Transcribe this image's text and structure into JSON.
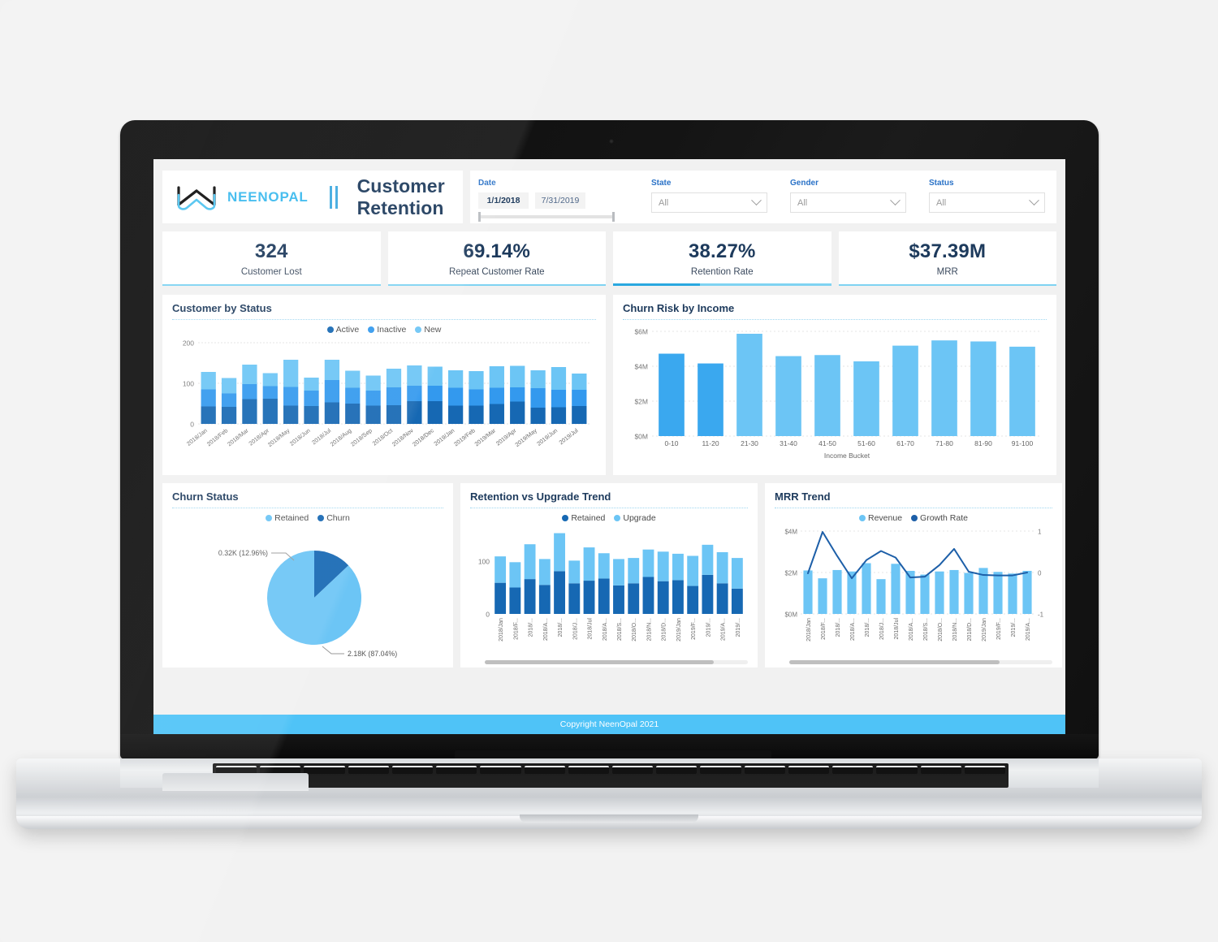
{
  "brand": {
    "name": "NEENOPAL",
    "logo_icon": "infinity-logo-icon"
  },
  "header": {
    "title": "Customer Retention"
  },
  "filters": {
    "date": {
      "label": "Date",
      "start": "1/1/2018",
      "end": "7/31/2019"
    },
    "state": {
      "label": "State",
      "value": "All"
    },
    "gender": {
      "label": "Gender",
      "value": "All"
    },
    "status": {
      "label": "Status",
      "value": "All"
    }
  },
  "kpis": [
    {
      "value": "324",
      "label": "Customer Lost"
    },
    {
      "value": "69.14%",
      "label": "Repeat Customer Rate"
    },
    {
      "value": "38.27%",
      "label": "Retention Rate"
    },
    {
      "value": "$37.39M",
      "label": "MRR"
    }
  ],
  "colors": {
    "dark_blue": "#1668b3",
    "mid_blue": "#3399ee",
    "light_blue": "#6cc5f5",
    "accent": "#4fc3f7",
    "title": "#1d3a5c"
  },
  "cards": {
    "customer_by_status": {
      "title": "Customer by Status"
    },
    "churn_risk": {
      "title": "Churn Risk by Income"
    },
    "churn_status": {
      "title": "Churn Status"
    },
    "retention_upgrade": {
      "title": "Retention vs Upgrade Trend"
    },
    "mrr_trend": {
      "title": "MRR Trend"
    }
  },
  "footer": {
    "text": "Copyright NeenOpal 2021"
  },
  "chart_data": [
    {
      "id": "customer_by_status",
      "type": "bar",
      "stacked": true,
      "title": "Customer by Status",
      "xlabel": "",
      "ylabel": "",
      "ylim": [
        0,
        200
      ],
      "yticks": [
        "0",
        "100",
        "200"
      ],
      "grid": true,
      "legend": [
        "Active",
        "Inactive",
        "New"
      ],
      "legend_position": "top-center",
      "legend_colors": [
        "#1668b3",
        "#3399ee",
        "#6cc5f5"
      ],
      "categories": [
        "2018/Jan",
        "2018/Feb",
        "2018/Mar",
        "2018/Apr",
        "2018/May",
        "2018/Jun",
        "2018/Jul",
        "2018/Aug",
        "2018/Sep",
        "2018/Oct",
        "2018/Nov",
        "2018/Dec",
        "2019/Jan",
        "2019/Feb",
        "2019/Mar",
        "2019/Apr",
        "2019/May",
        "2019/Jun",
        "2019/Jul"
      ],
      "series": [
        {
          "name": "Active",
          "color": "#1668b3",
          "values": [
            43,
            42,
            61,
            62,
            45,
            44,
            53,
            50,
            45,
            46,
            56,
            56,
            45,
            45,
            49,
            55,
            40,
            41,
            44
          ]
        },
        {
          "name": "Inactive",
          "color": "#3399ee",
          "values": [
            42,
            33,
            37,
            31,
            46,
            38,
            55,
            39,
            37,
            44,
            38,
            38,
            44,
            40,
            40,
            35,
            48,
            43,
            40
          ]
        },
        {
          "name": "New",
          "color": "#6cc5f5",
          "values": [
            43,
            38,
            48,
            32,
            67,
            32,
            50,
            42,
            37,
            46,
            50,
            47,
            43,
            45,
            53,
            53,
            44,
            56,
            40
          ]
        }
      ]
    },
    {
      "id": "churn_risk",
      "type": "bar",
      "title": "Churn Risk by Income",
      "xlabel": "Income Bucket",
      "ylabel": "",
      "ylim": [
        0,
        6
      ],
      "yticks": [
        "$0M",
        "$2M",
        "$4M",
        "$6M"
      ],
      "grid": true,
      "categories": [
        "0-10",
        "11-20",
        "21-30",
        "31-40",
        "41-50",
        "51-60",
        "61-70",
        "71-80",
        "81-90",
        "91-100"
      ],
      "values": [
        4.72,
        4.16,
        5.86,
        4.58,
        4.64,
        4.28,
        5.18,
        5.48,
        5.42,
        5.12
      ],
      "bar_color": "#6cc5f5",
      "highlight_color": "#3aa8ef",
      "highlighted": [
        "0-10",
        "11-20"
      ]
    },
    {
      "id": "churn_status",
      "type": "pie",
      "title": "Churn Status",
      "legend": [
        "Retained",
        "Churn"
      ],
      "legend_position": "top-center",
      "slices": [
        {
          "name": "Retained",
          "value": 2.18,
          "percent": 87.04,
          "label": "2.18K (87.04%)",
          "color": "#6cc5f5"
        },
        {
          "name": "Churn",
          "value": 0.32,
          "percent": 12.96,
          "label": "0.32K (12.96%)",
          "color": "#1668b3"
        }
      ]
    },
    {
      "id": "retention_upgrade",
      "type": "bar",
      "stacked": true,
      "title": "Retention vs Upgrade Trend",
      "ylim": [
        0,
        160
      ],
      "yticks": [
        "0",
        "100"
      ],
      "grid": false,
      "legend": [
        "Retained",
        "Upgrade"
      ],
      "legend_position": "top-center",
      "legend_colors": [
        "#1668b3",
        "#6cc5f5"
      ],
      "categories": [
        "2018/Jan",
        "2018/F...",
        "2018/...",
        "2018/A...",
        "2018/...",
        "2018/J...",
        "2018/Jul",
        "2018/A...",
        "2018/S...",
        "2018/O...",
        "2018/N...",
        "2018/D...",
        "2019/Jan",
        "2019/F...",
        "2019/...",
        "2019/A...",
        "2019/..."
      ],
      "series": [
        {
          "name": "Retained",
          "color": "#1668b3",
          "values": [
            59,
            50,
            66,
            55,
            81,
            58,
            63,
            67,
            54,
            58,
            70,
            62,
            64,
            53,
            74,
            58,
            48
          ]
        },
        {
          "name": "Upgrade",
          "color": "#6cc5f5",
          "values": [
            50,
            48,
            66,
            49,
            72,
            43,
            63,
            48,
            50,
            48,
            52,
            56,
            50,
            57,
            57,
            59,
            58
          ]
        }
      ]
    },
    {
      "id": "mrr_trend",
      "type": "line",
      "combo": "bar+line",
      "title": "MRR Trend",
      "ylim": [
        0,
        4
      ],
      "yticks": [
        "$0M",
        "$2M",
        "$4M"
      ],
      "y2lim": [
        -1,
        1
      ],
      "y2ticks": [
        "-1",
        "0",
        "1"
      ],
      "grid": true,
      "legend": [
        "Revenue",
        "Growth Rate"
      ],
      "legend_position": "top-center",
      "legend_colors": [
        "#6cc5f5",
        "#1d5fa8"
      ],
      "categories": [
        "2018/Jan",
        "2018/F...",
        "2018/...",
        "2018/A...",
        "2018/...",
        "2018/J...",
        "2018/Jul",
        "2018/A...",
        "2018/S...",
        "2018/O...",
        "2018/N...",
        "2018/D...",
        "2019/Jan",
        "2019/F...",
        "2019/...",
        "2019/A..."
      ],
      "series": [
        {
          "name": "Revenue",
          "kind": "bar",
          "color": "#6cc5f5",
          "values": [
            2.1,
            1.72,
            2.12,
            2.05,
            2.45,
            1.68,
            2.42,
            2.08,
            1.9,
            2.05,
            2.12,
            1.98,
            2.22,
            2.03,
            1.95,
            2.08
          ]
        },
        {
          "name": "Growth Rate",
          "kind": "line",
          "color": "#1d5fa8",
          "values": [
            -0.02,
            0.98,
            0.4,
            -0.14,
            0.3,
            0.52,
            0.36,
            -0.12,
            -0.1,
            0.18,
            0.57,
            0.02,
            -0.06,
            -0.07,
            -0.07,
            0.0
          ]
        }
      ]
    }
  ]
}
